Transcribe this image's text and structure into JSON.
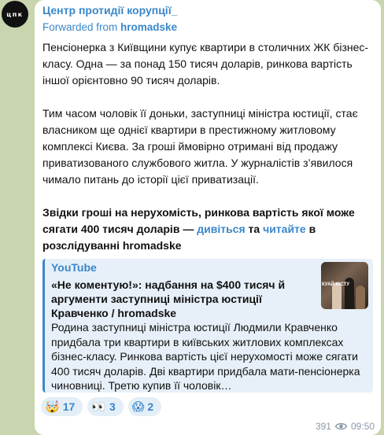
{
  "channel": {
    "avatar_text": "цпк",
    "name": "Центр протидії корупції_",
    "forwarded_prefix": "Forwarded from",
    "forwarded_source": "hromadske"
  },
  "message": {
    "p1": "Пенсіонерка з Київщини купує квартири в столичних ЖК бізнес-класу. Одна — за понад 150 тисяч доларів, ринкова вартість іншої орієнтовно 90 тисяч доларів.",
    "p2": "Тим часом чоловік її доньки, заступниці міністра юстиції, стає власником ще однієї квартири в престижному житловому комплексі Києва. За гроші ймовірно отримані від продажу приватизованого службового житла. У журналістів з’явилося чимало питань до історії цієї приватизації.",
    "p3_start": "Звідки гроші на нерухомість, ринкова вартість якої може сягати 400 тисяч доларів — ",
    "p3_link1": "дивіться",
    "p3_mid": " та ",
    "p3_link2": "читайте",
    "p3_end": " в розслідуванні hromadske"
  },
  "preview": {
    "site": "YouTube",
    "title": "«Не коментую!»: надбання на $400 тисяч й аргументи заступниці міністра юстиції Кравченко / hromadske",
    "description": "Родина заступниці міністра юстиції Людмили Кравченко придбала три квартири в київських житлових комплексах бізнес-класу. Ринкова вартість цієї нерухомості може сягати 400 тисяч доларів. Дві квартири придбала мати-пенсіонерка чиновниці. Третю купив її чоловік…",
    "thumb_text": "КУАЙ ЮСТУ"
  },
  "reactions": [
    {
      "emoji": "🤯",
      "count": "17"
    },
    {
      "emoji": "👀",
      "count": "3"
    },
    {
      "emoji": "😱",
      "count": "2"
    }
  ],
  "meta": {
    "views": "391",
    "time": "09:50"
  },
  "colors": {
    "accent": "#3a87c9",
    "background": "#c9d5ae",
    "preview_bg": "#e7f0f8"
  }
}
